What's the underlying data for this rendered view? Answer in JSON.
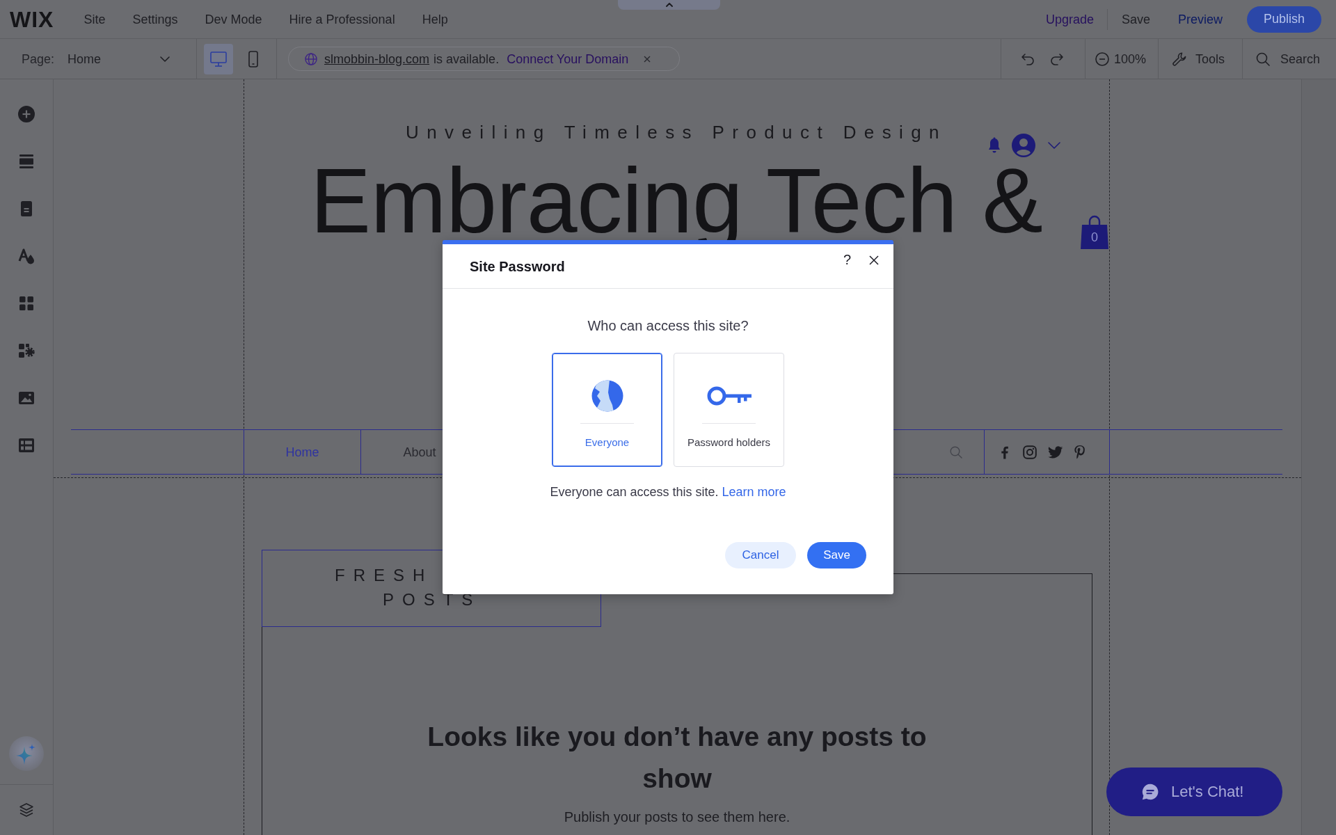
{
  "top_bar": {
    "logo": "WIX",
    "menu": [
      "Site",
      "Settings",
      "Dev Mode",
      "Hire a Professional",
      "Help"
    ],
    "upgrade": "Upgrade",
    "save": "Save",
    "preview": "Preview",
    "publish": "Publish"
  },
  "toolbar": {
    "page_label": "Page:",
    "page": "Home",
    "devices": [
      {
        "kind": "desktop",
        "selected": true
      },
      {
        "kind": "mobile",
        "selected": false
      }
    ],
    "domain_banner": {
      "domain": "slmobbin-blog.com",
      "message": "is available.",
      "link": "Connect Your Domain"
    },
    "zoom": "100%",
    "tools": "Tools",
    "search": "Search"
  },
  "site": {
    "tagline": "Unveiling Timeless Product Design",
    "headline": "Embracing Tech &",
    "cart_count": "0",
    "nav": [
      {
        "label": "Home",
        "selected": true
      },
      {
        "label": "About",
        "selected": false
      }
    ],
    "blog_title_lines": [
      "FRESH",
      "POSTS"
    ],
    "empty_title": "Looks like you don’t have any posts to show",
    "empty_text": "Publish your posts to see them here.",
    "chat_button": "Let's Chat!"
  },
  "dialog": {
    "title": "Site Password",
    "help": "?",
    "question": "Who can access this site?",
    "options": [
      {
        "kind": "everyone",
        "label": "Everyone",
        "selected": true
      },
      {
        "kind": "password",
        "label": "Password holders",
        "selected": false
      }
    ],
    "description": "Everyone can access this site.",
    "learn_more": "Learn more",
    "buttons": [
      {
        "kind": "secondary",
        "label": "Cancel"
      },
      {
        "kind": "primary",
        "label": "Save"
      }
    ]
  }
}
